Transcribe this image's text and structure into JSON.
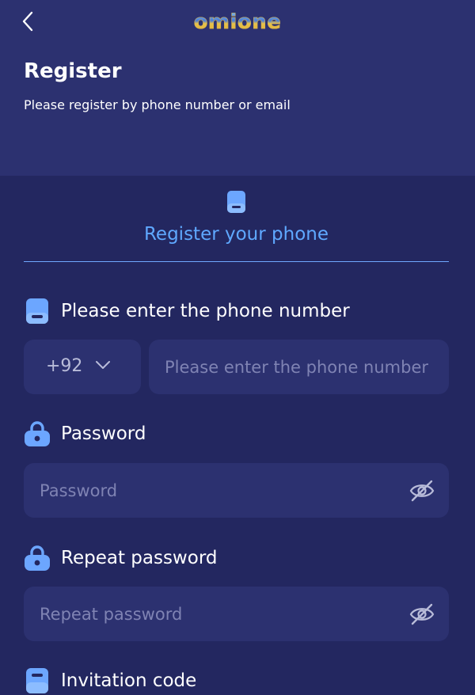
{
  "header": {
    "back_icon": "chevron-left-icon",
    "logo_text": "omione",
    "title": "Register",
    "subtitle": "Please register by phone number or email"
  },
  "tabs": [
    {
      "label": "Register your phone",
      "icon": "phone-icon",
      "active": true
    }
  ],
  "form": {
    "phone": {
      "label": "Please enter the phone number",
      "icon": "phone-icon",
      "country_code": "+92",
      "placeholder": "Please enter the phone number",
      "value": ""
    },
    "password": {
      "label": "Password",
      "icon": "lock-icon",
      "placeholder": "Password",
      "value": "",
      "toggle_icon": "eye-off-icon"
    },
    "repeat_password": {
      "label": "Repeat password",
      "icon": "lock-icon",
      "placeholder": "Repeat password",
      "value": "",
      "toggle_icon": "eye-off-icon"
    },
    "invitation_code": {
      "label": "Invitation code",
      "icon": "invitation-icon"
    }
  },
  "colors": {
    "background": "#232760",
    "header_background": "#2c3170",
    "input_background": "#2c3170",
    "accent": "#5fa8ff",
    "placeholder": "#7f83b3",
    "icon_fill": "#6ca6ff"
  }
}
